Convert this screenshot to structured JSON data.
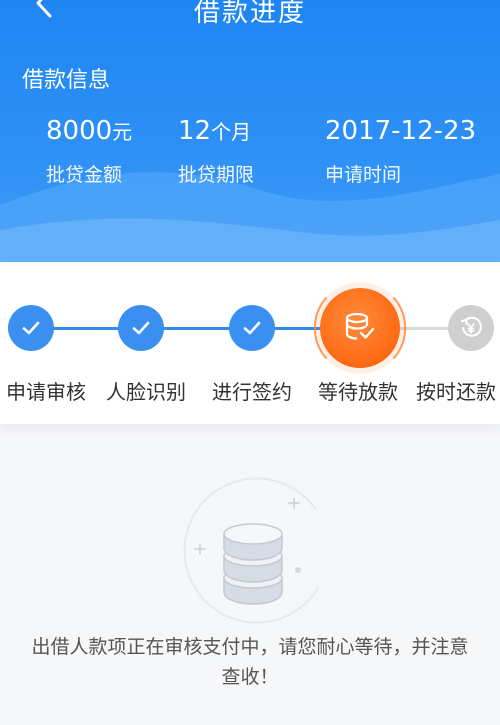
{
  "nav": {
    "title": "借款进度"
  },
  "loan": {
    "title": "借款信息",
    "stats": [
      {
        "value": "8000",
        "unit": "元",
        "label": "批贷金额"
      },
      {
        "value": "12",
        "unit": "个月",
        "label": "批贷期限"
      },
      {
        "value": "2017-12-23",
        "unit": "",
        "label": "申请时间"
      }
    ]
  },
  "progress": {
    "steps": [
      {
        "label": "申请审核",
        "state": "done",
        "icon": "check-icon"
      },
      {
        "label": "人脸识别",
        "state": "done",
        "icon": "check-icon"
      },
      {
        "label": "进行签约",
        "state": "done",
        "icon": "check-icon"
      },
      {
        "label": "等待放款",
        "state": "current",
        "icon": "coin-stack-check-icon"
      },
      {
        "label": "按时还款",
        "state": "pending",
        "icon": "yen-return-icon"
      }
    ]
  },
  "status": {
    "icon": "coin-stack-icon",
    "message": "出借人款项正在审核支付中，请您耐心等待，并注意查收！"
  },
  "colors": {
    "primary_blue": "#2f8bf2",
    "current_orange": "#ff6a14",
    "pending_gray": "#cfcfcf"
  }
}
